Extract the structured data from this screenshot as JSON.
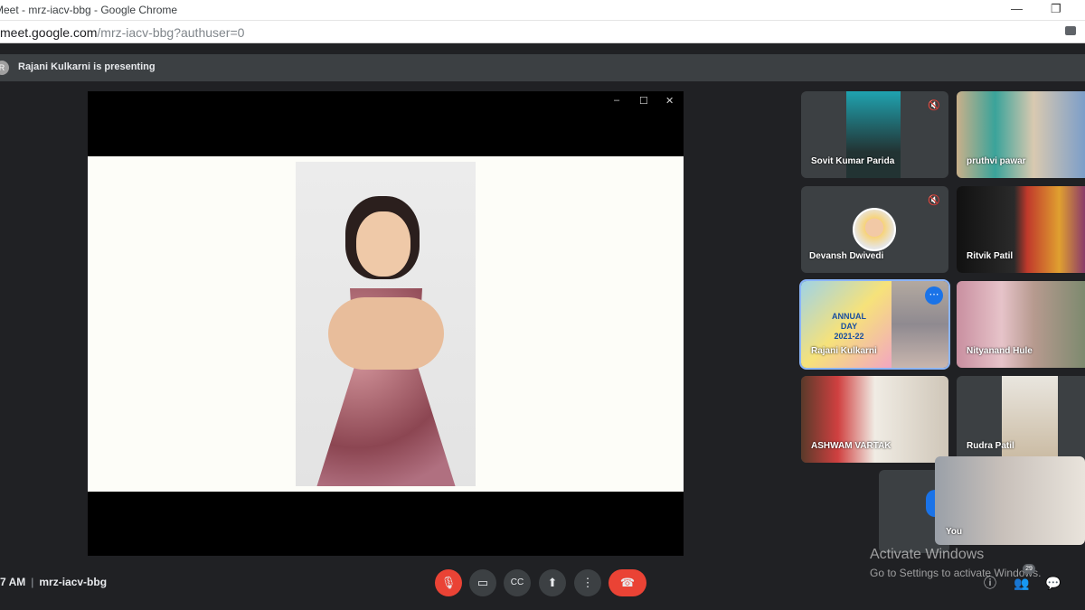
{
  "browser": {
    "window_title": "Meet - mrz-iacv-bbg - Google Chrome",
    "url_host": "meet.google.com",
    "url_path": "/mrz-iacv-bbg?authuser=0",
    "minimize": "—",
    "restore": "❐"
  },
  "banner": {
    "avatar_letter": "R",
    "text": "Rajani Kulkarni is presenting"
  },
  "stage": {
    "min": "–",
    "max": "☐",
    "close": "✕"
  },
  "participants": [
    {
      "name": "Sovit Kumar Parida",
      "muted": true
    },
    {
      "name": "pruthvi pawar",
      "muted": false
    },
    {
      "name": "Devansh Dwivedi",
      "muted": true
    },
    {
      "name": "Ritvik Patil",
      "muted": false
    },
    {
      "name": "Rajani Kulkarni",
      "muted": false,
      "slide_lines": [
        "ANNUAL",
        "DAY",
        "2021-22"
      ]
    },
    {
      "name": "Nityanand Hule",
      "muted": false
    },
    {
      "name": "ASHWAM VARTAK",
      "muted": false
    },
    {
      "name": "Rudra Patil",
      "muted": false
    }
  ],
  "self": {
    "name": "You"
  },
  "watermark": {
    "line1": "Activate Windows",
    "line2": "Go to Settings to activate Windows."
  },
  "meeting": {
    "time": "7 AM",
    "separator": "|",
    "code": "mrz-iacv-bbg"
  },
  "controls": {
    "mic": "🎙",
    "camera": "▭",
    "captions": "CC",
    "present": "⬆",
    "more": "⋮",
    "end": "☎"
  },
  "right_controls": {
    "info": "ⓘ",
    "people": "👥",
    "people_count": "29",
    "chat": "💬"
  },
  "colors": {
    "accent": "#1a73e8",
    "danger": "#ea4335",
    "background": "#202124",
    "tile": "#3c4043"
  }
}
